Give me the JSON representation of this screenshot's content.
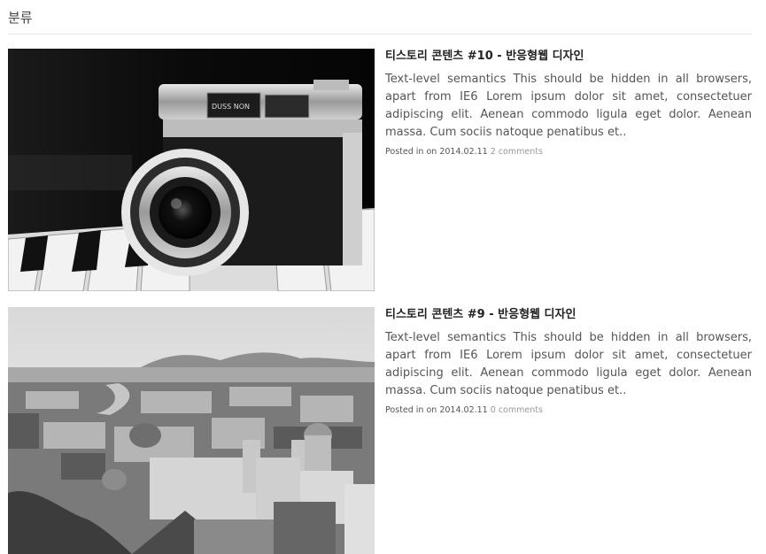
{
  "category": {
    "title": "분류"
  },
  "posts": [
    {
      "title": "티스토리 콘텐츠 #10 - 반응형웹 디자인",
      "excerpt": "Text-level semantics This should be hidden in all browsers, apart from IE6 Lorem ipsum dolor sit amet, consectetuer adipiscing elit. Aenean commodo ligula eget dolor. Aenean massa. Cum sociis natoque penatibus et..",
      "posted_label": "Posted in on",
      "date": "2014.02.11",
      "comments": "2 comments",
      "thumbnail": "camera-photo",
      "camera_badge": "DUSS NON"
    },
    {
      "title": "티스토리 콘텐츠 #9 - 반응형웹 디자인",
      "excerpt": "Text-level semantics This should be hidden in all browsers, apart from IE6 Lorem ipsum dolor sit amet, consectetuer adipiscing elit. Aenean commodo ligula eget dolor. Aenean massa. Cum sociis natoque penatibus et..",
      "posted_label": "Posted in on",
      "date": "2014.02.11",
      "comments": "0 comments",
      "thumbnail": "city-photo"
    }
  ]
}
